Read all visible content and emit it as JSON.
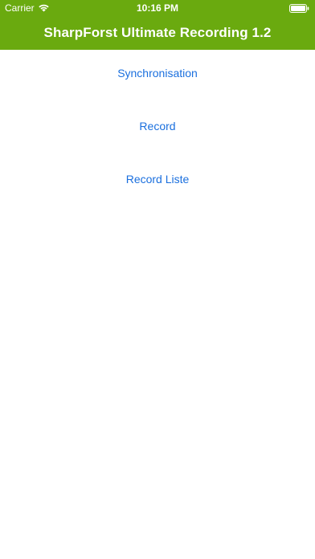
{
  "status_bar": {
    "carrier": "Carrier",
    "time": "10:16 PM",
    "wifi_icon": "wifi-icon",
    "battery_icon": "battery-icon"
  },
  "header": {
    "title": "SharpForst Ultimate Recording 1.2",
    "background_color": "#6aaa0f"
  },
  "menu": {
    "link_color": "#1a6fde",
    "items": [
      {
        "label": "Synchronisation"
      },
      {
        "label": "Record"
      },
      {
        "label": "Record Liste"
      }
    ]
  }
}
